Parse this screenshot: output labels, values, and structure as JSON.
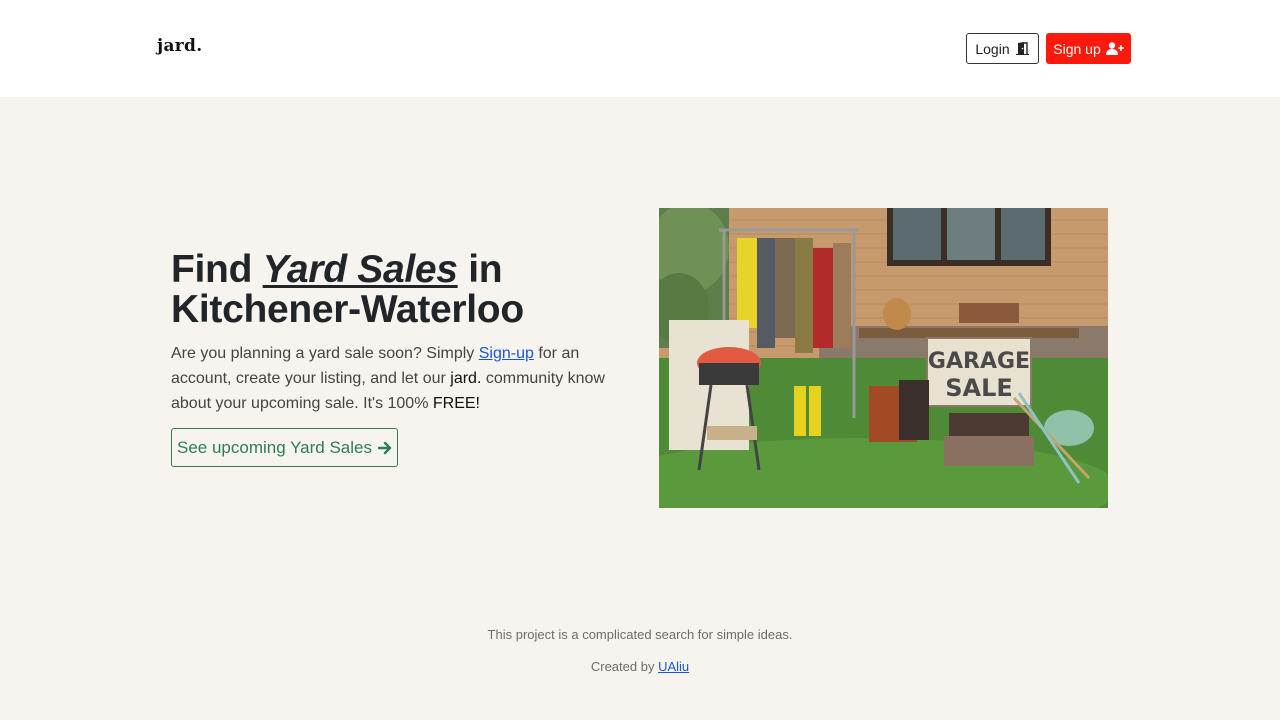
{
  "header": {
    "brand": "jard.",
    "login_label": "Login",
    "signup_label": "Sign up"
  },
  "hero": {
    "title_find": "Find",
    "title_em": "Yard Sales",
    "title_in": "in",
    "title_city": "Kitchener-Waterloo",
    "text_1": "Are you planning a yard sale soon? Simply ",
    "text_link": "Sign-up",
    "text_2": " for an account, create your listing, and let our ",
    "text_brand": "jard.",
    "text_3": " community know about your upcoming sale. It's 100% ",
    "text_free": "FREE!",
    "cta_label": "See upcoming Yard Sales",
    "image_sign_line1": "GARAGE",
    "image_sign_line2": "SALE"
  },
  "footer": {
    "tagline": "This project is a complicated search for simple ideas.",
    "created_by": "Created by ",
    "author": "UAliu"
  },
  "colors": {
    "accent_red": "#fc1a0d",
    "cta_green": "#2e7d52",
    "link_blue": "#1a56db",
    "page_bg": "#f7f4ef"
  },
  "icons": {
    "login": "door-open-icon",
    "signup": "user-plus-icon",
    "cta": "arrow-right-icon"
  }
}
